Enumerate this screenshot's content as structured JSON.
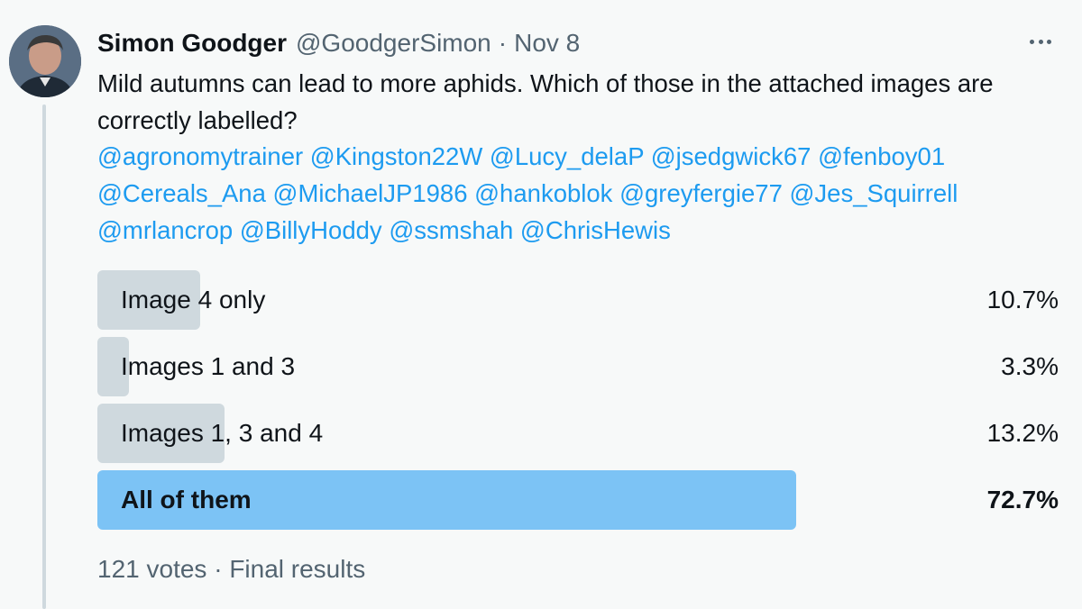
{
  "tweet": {
    "author_name": "Simon Goodger",
    "author_handle": "@GoodgerSimon",
    "separator": "·",
    "date": "Nov 8",
    "text": "Mild autumns can lead to more aphids. Which of those in the attached images are correctly labelled?",
    "mentions": [
      "@agronomytrainer",
      "@Kingston22W",
      "@Lucy_delaP",
      "@jsedgwick67",
      "@fenboy01",
      "@Cereals_Ana",
      "@MichaelJP1986",
      "@hankoblok",
      "@greyfergie77",
      "@Jes_Squirrell",
      "@mrlancrop",
      "@BillyHoddy",
      "@ssmshah",
      "@ChrisHewis"
    ]
  },
  "poll": {
    "options": [
      {
        "label": "Image 4 only",
        "percent": "10.7%",
        "share": 10.7,
        "winner": false
      },
      {
        "label": "Images 1 and 3",
        "percent": "3.3%",
        "share": 3.3,
        "winner": false
      },
      {
        "label": "Images 1, 3 and 4",
        "percent": "13.2%",
        "share": 13.2,
        "winner": false
      },
      {
        "label": "All of them",
        "percent": "72.7%",
        "share": 72.7,
        "winner": true
      }
    ],
    "votes": "121 votes",
    "separator": "·",
    "status": "Final results"
  },
  "colors": {
    "bar": "#cfd9de",
    "winner_bar": "#7cc3f5",
    "mention": "#1d9bf0",
    "secondary_text": "#536471"
  },
  "icons": {
    "more": "more-horizontal-icon"
  }
}
